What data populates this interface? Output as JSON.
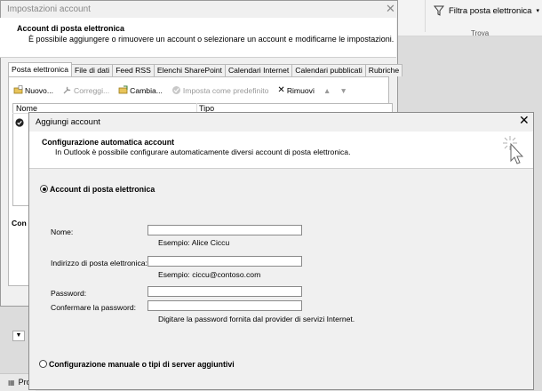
{
  "ribbon": {
    "filter_label": "Filtra posta elettronica",
    "group_label": "Trova",
    "bottom_label": "Pro"
  },
  "account_settings": {
    "title": "Impostazioni account",
    "heading": "Account di posta elettronica",
    "subheading": "È possibile aggiungere o rimuovere un account o selezionare un account e modificarne le impostazioni.",
    "tabs": [
      "Posta elettronica",
      "File di dati",
      "Feed RSS",
      "Elenchi SharePoint",
      "Calendari Internet",
      "Calendari pubblicati",
      "Rubriche"
    ],
    "toolbar": {
      "new": "Nuovo...",
      "repair": "Correggi...",
      "change": "Cambia...",
      "default": "Imposta come predefinito",
      "remove": "Rimuovi"
    },
    "columns": {
      "name": "Nome",
      "type": "Tipo"
    },
    "connect_label": "Con"
  },
  "add_account": {
    "title": "Aggiungi account",
    "heading": "Configurazione automatica account",
    "subheading": "In Outlook è possibile configurare automaticamente diversi account di posta elettronica.",
    "option_email": "Account di posta elettronica",
    "fields": {
      "name_label": "Nome:",
      "name_hint": "Esempio: Alice Ciccu",
      "email_label": "Indirizzo di posta elettronica:",
      "email_hint": "Esempio: ciccu@contoso.com",
      "password_label": "Password:",
      "confirm_label": "Confermare la password:",
      "password_hint": "Digitare la password fornita dal provider di servizi Internet."
    },
    "option_manual": "Configurazione manuale o tipi di server aggiuntivi"
  },
  "colors": {
    "accent": "#1e64b4",
    "disabled": "#9a9a9a"
  }
}
